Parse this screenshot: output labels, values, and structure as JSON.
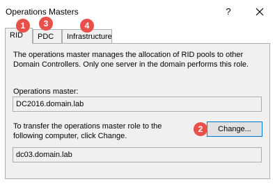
{
  "window": {
    "title": "Operations Masters",
    "help_glyph": "?"
  },
  "tabs": [
    {
      "label": "RID",
      "badge": "1",
      "selected": true
    },
    {
      "label": "PDC",
      "badge": "3",
      "selected": false
    },
    {
      "label": "Infrastructure",
      "badge": "4",
      "selected": false
    }
  ],
  "rid": {
    "description": "The operations master manages the allocation of RID pools to other Domain Controllers. Only one server in the domain performs this role.",
    "operations_master_label": "Operations master:",
    "operations_master_value": "DC2016.domain.lab",
    "transfer_text": "To transfer the operations master role to the following computer, click Change.",
    "change_button": "Change...",
    "change_badge": "2",
    "target_value": "dc03.domain.lab"
  },
  "colors": {
    "badge": "#e8504a",
    "panel": "#f0f0f0",
    "focus_border": "#0078d7"
  },
  "icons": {
    "close": "close-icon"
  }
}
